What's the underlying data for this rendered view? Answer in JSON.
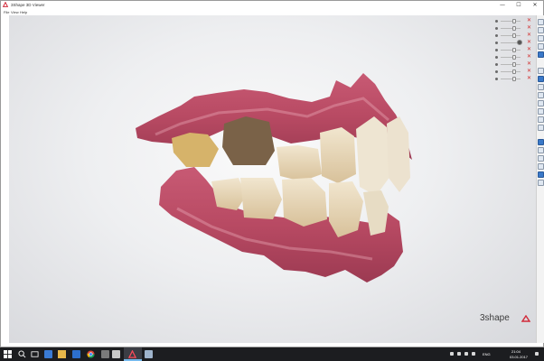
{
  "window": {
    "title": "3Shape 3D Viewer"
  },
  "window_controls": {
    "minimize": "—",
    "maximize": "☐",
    "close": "✕"
  },
  "menu": {
    "items": [
      "File",
      "View",
      "Help"
    ]
  },
  "viewport": {
    "content": "3D intraoral scan of upper and lower teeth in occlusion",
    "background_color": "#e8e9eb",
    "gum_color": "#b84a63",
    "tooth_color": "#e6d7b8"
  },
  "layers": {
    "rows": [
      {
        "opacity": 0.6
      },
      {
        "opacity": 0.6
      },
      {
        "opacity": 0.6
      },
      {
        "opacity": 0.85,
        "special": "sphere"
      },
      {
        "opacity": 0.6
      },
      {
        "opacity": 0.6
      },
      {
        "opacity": 0.6
      },
      {
        "opacity": 0.6
      },
      {
        "opacity": 0.6
      }
    ],
    "remove_color": "#d23030"
  },
  "brand": {
    "text": "3shape",
    "mark_color": "#d12a3a"
  },
  "taskbar": {
    "tray": {
      "lang": "ENG",
      "time": "21:04",
      "date": "03.01.2017"
    }
  }
}
